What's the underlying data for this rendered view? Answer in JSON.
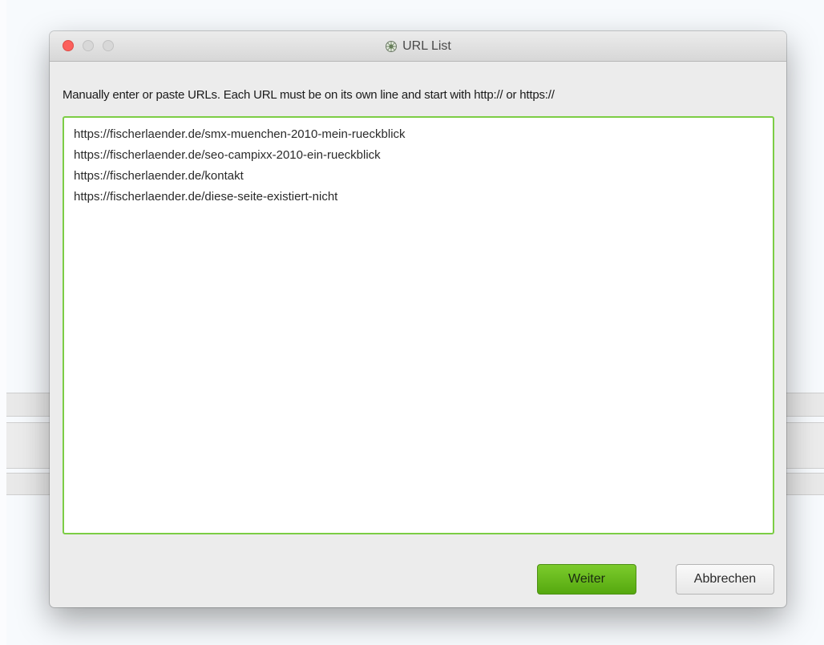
{
  "window": {
    "title": "URL List",
    "title_icon": "spider-icon"
  },
  "instruction": "Manually enter or paste URLs. Each URL must be on its own line and start with http:// or https://",
  "url_list": [
    "https://fischerlaender.de/smx-muenchen-2010-mein-rueckblick",
    "https://fischerlaender.de/seo-campixx-2010-ein-rueckblick",
    "https://fischerlaender.de/kontakt",
    "https://fischerlaender.de/diese-seite-existiert-nicht"
  ],
  "buttons": {
    "primary_label": "Weiter",
    "cancel_label": "Abbrechen"
  },
  "colors": {
    "accent_green": "#6cbf1f",
    "focus_border": "#7ccd45",
    "close_red": "#fc605c"
  }
}
